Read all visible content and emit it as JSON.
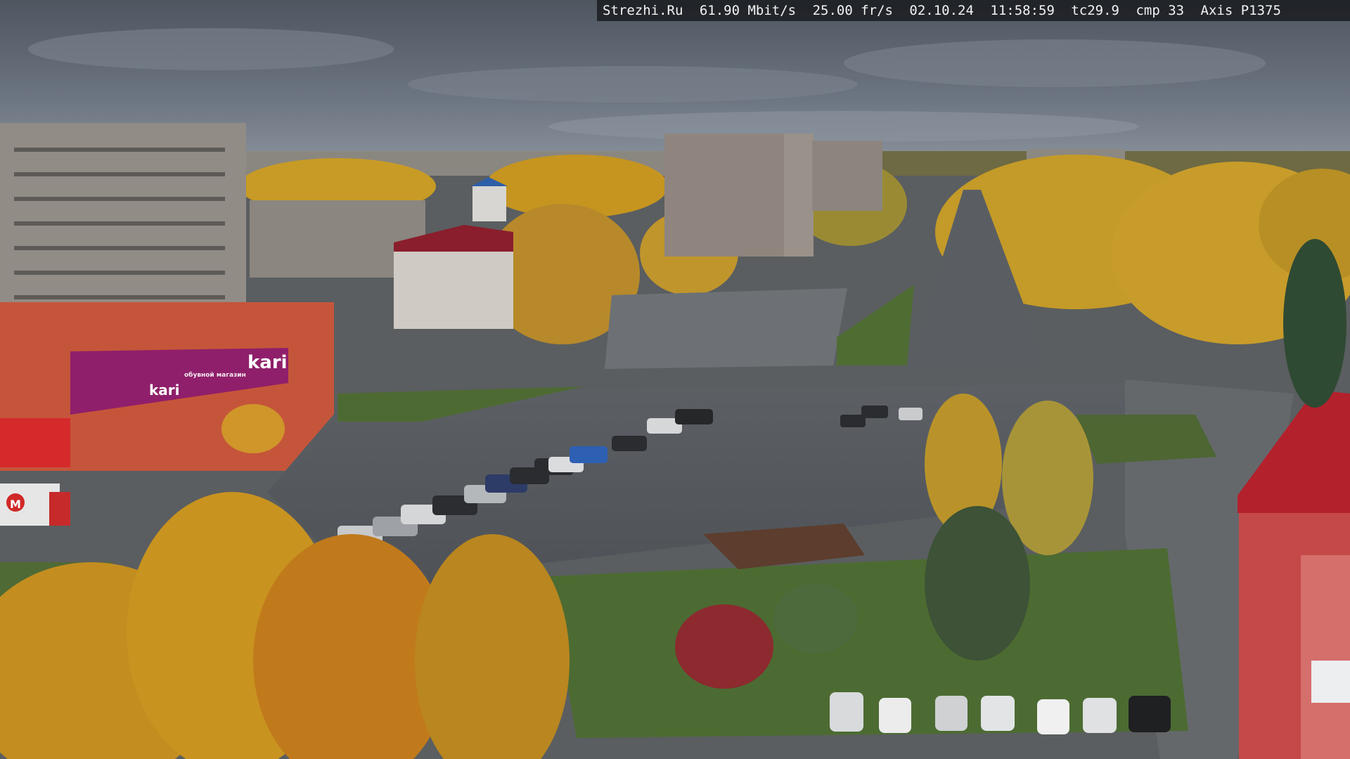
{
  "overlay": {
    "site": "Strezhi.Ru",
    "bitrate": "61.90 Mbit/s",
    "framerate": "25.00 fr/s",
    "date": "02.10.24",
    "time": "11:58:59",
    "temperature": "tc29.9",
    "compression": "cmp 33",
    "camera_model": "Axis P1375"
  },
  "signs": {
    "store_big": "kari",
    "store_small": "kari",
    "store_tagline": "обувной магазин",
    "truck_logo": "M"
  },
  "colors": {
    "sky": "#5f6873",
    "autumn_foliage": "#c89a1e",
    "road": "#55595e",
    "lawn": "#4f6a35",
    "store_sign": "#8f1f6a",
    "brick": "#c9563b"
  }
}
